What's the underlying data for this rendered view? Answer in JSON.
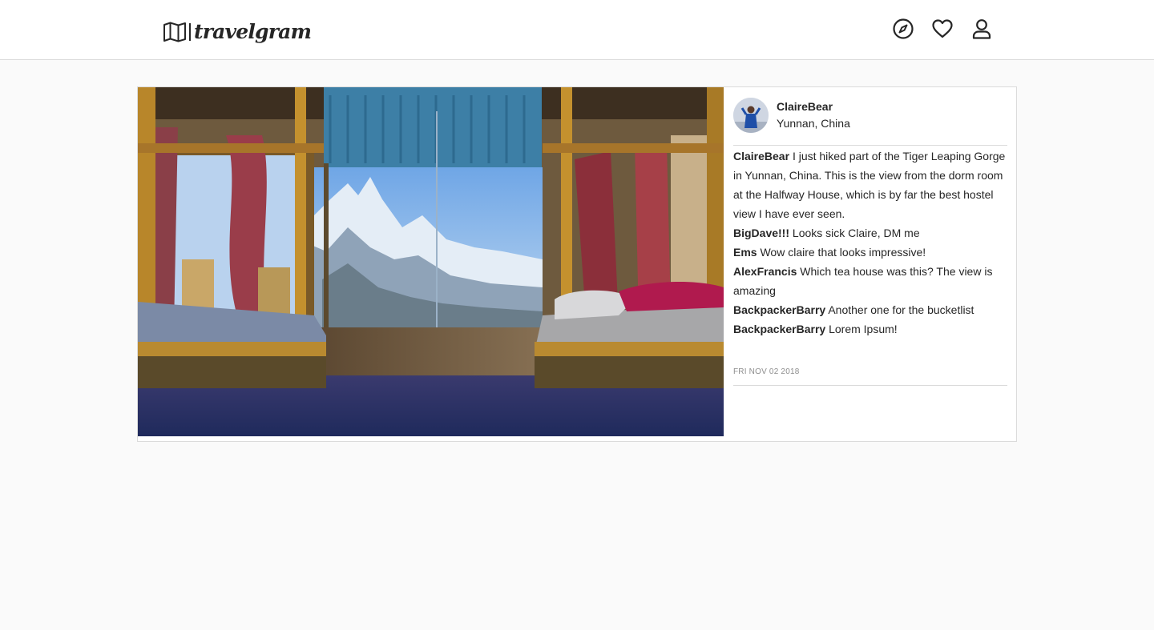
{
  "header": {
    "brand": "travelgram",
    "icons": [
      "map-icon",
      "compass-icon",
      "heart-icon",
      "user-icon"
    ]
  },
  "post": {
    "author": {
      "username": "ClaireBear",
      "location": "Yunnan, China"
    },
    "comments": [
      {
        "user": "ClaireBear",
        "text": "I just hiked part of the Tiger Leaping Gorge in Yunnan, China. This is the view from the dorm room at the Halfway House, which is by far the best hostel view I have ever seen."
      },
      {
        "user": "BigDave!!!",
        "text": "Looks sick Claire, DM me"
      },
      {
        "user": "Ems",
        "text": "Wow claire that looks impressive!"
      },
      {
        "user": "AlexFrancis",
        "text": "Which tea house was this? The view is amazing"
      },
      {
        "user": "BackpackerBarry",
        "text": "Another one for the bucketlist"
      },
      {
        "user": "BackpackerBarry",
        "text": "Lorem Ipsum!"
      }
    ],
    "date": "FRI NOV 02 2018"
  },
  "colors": {
    "page_bg": "#fafafa",
    "card_bg": "#ffffff",
    "border": "#dbdbdb",
    "text": "#262626",
    "muted": "#8e8e8e"
  }
}
